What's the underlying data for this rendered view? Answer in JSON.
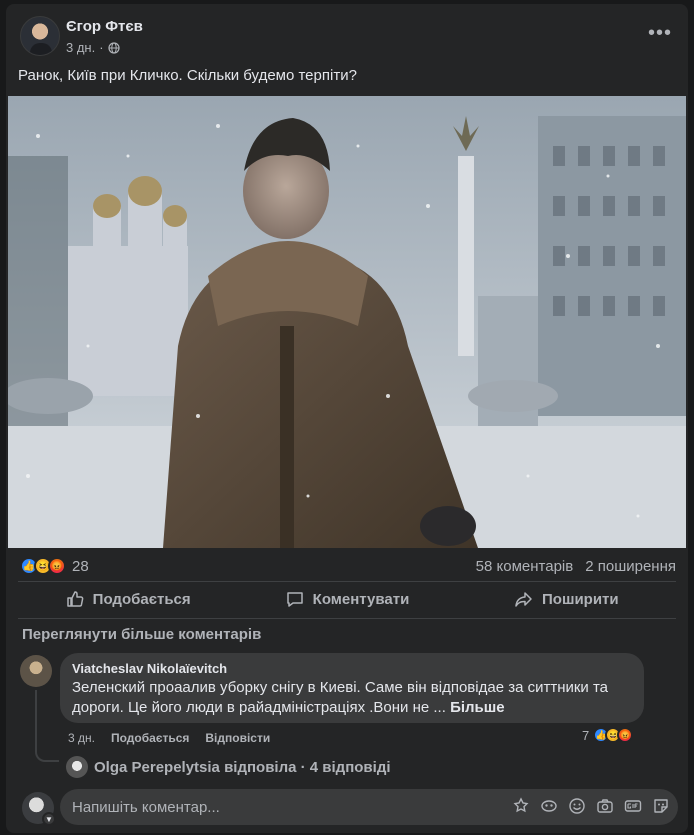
{
  "post": {
    "author": "Єгор Фтєв",
    "time": "3 дн.",
    "text": "Ранок, Київ при Кличко. Скільки будемо терпіти?",
    "more_label": "•••",
    "reactions": {
      "count": "28",
      "types": [
        "like",
        "haha",
        "angry"
      ]
    },
    "comments_count": "58 коментарів",
    "shares_count": "2 поширення"
  },
  "actions": {
    "like_label": "Подобається",
    "comment_label": "Коментувати",
    "share_label": "Поширити"
  },
  "comments": {
    "view_more": "Переглянути більше коментарів",
    "items": [
      {
        "author": "Viatcheslav Nikolaïevitch",
        "text": "Зеленский проаалив уборку снігу в Киеві. Саме він відповідае за ситтники та дороги. Це його люди в райадміністраціях .Вони не ...",
        "more_label": "Більше",
        "time": "3 дн.",
        "like_label": "Подобається",
        "reply_label": "Відповісти",
        "reaction_count": "7"
      }
    ],
    "reply_summary": "Olga Perepelytsia відповіла · 4 відповіді"
  },
  "composer": {
    "placeholder": "Напишіть коментар..."
  },
  "colors": {
    "background": "#18191a",
    "card": "#242526",
    "bubble": "#3a3b3c",
    "text_primary": "#e4e6eb",
    "text_secondary": "#b0b3b8",
    "like_blue": "#2d88ff"
  }
}
